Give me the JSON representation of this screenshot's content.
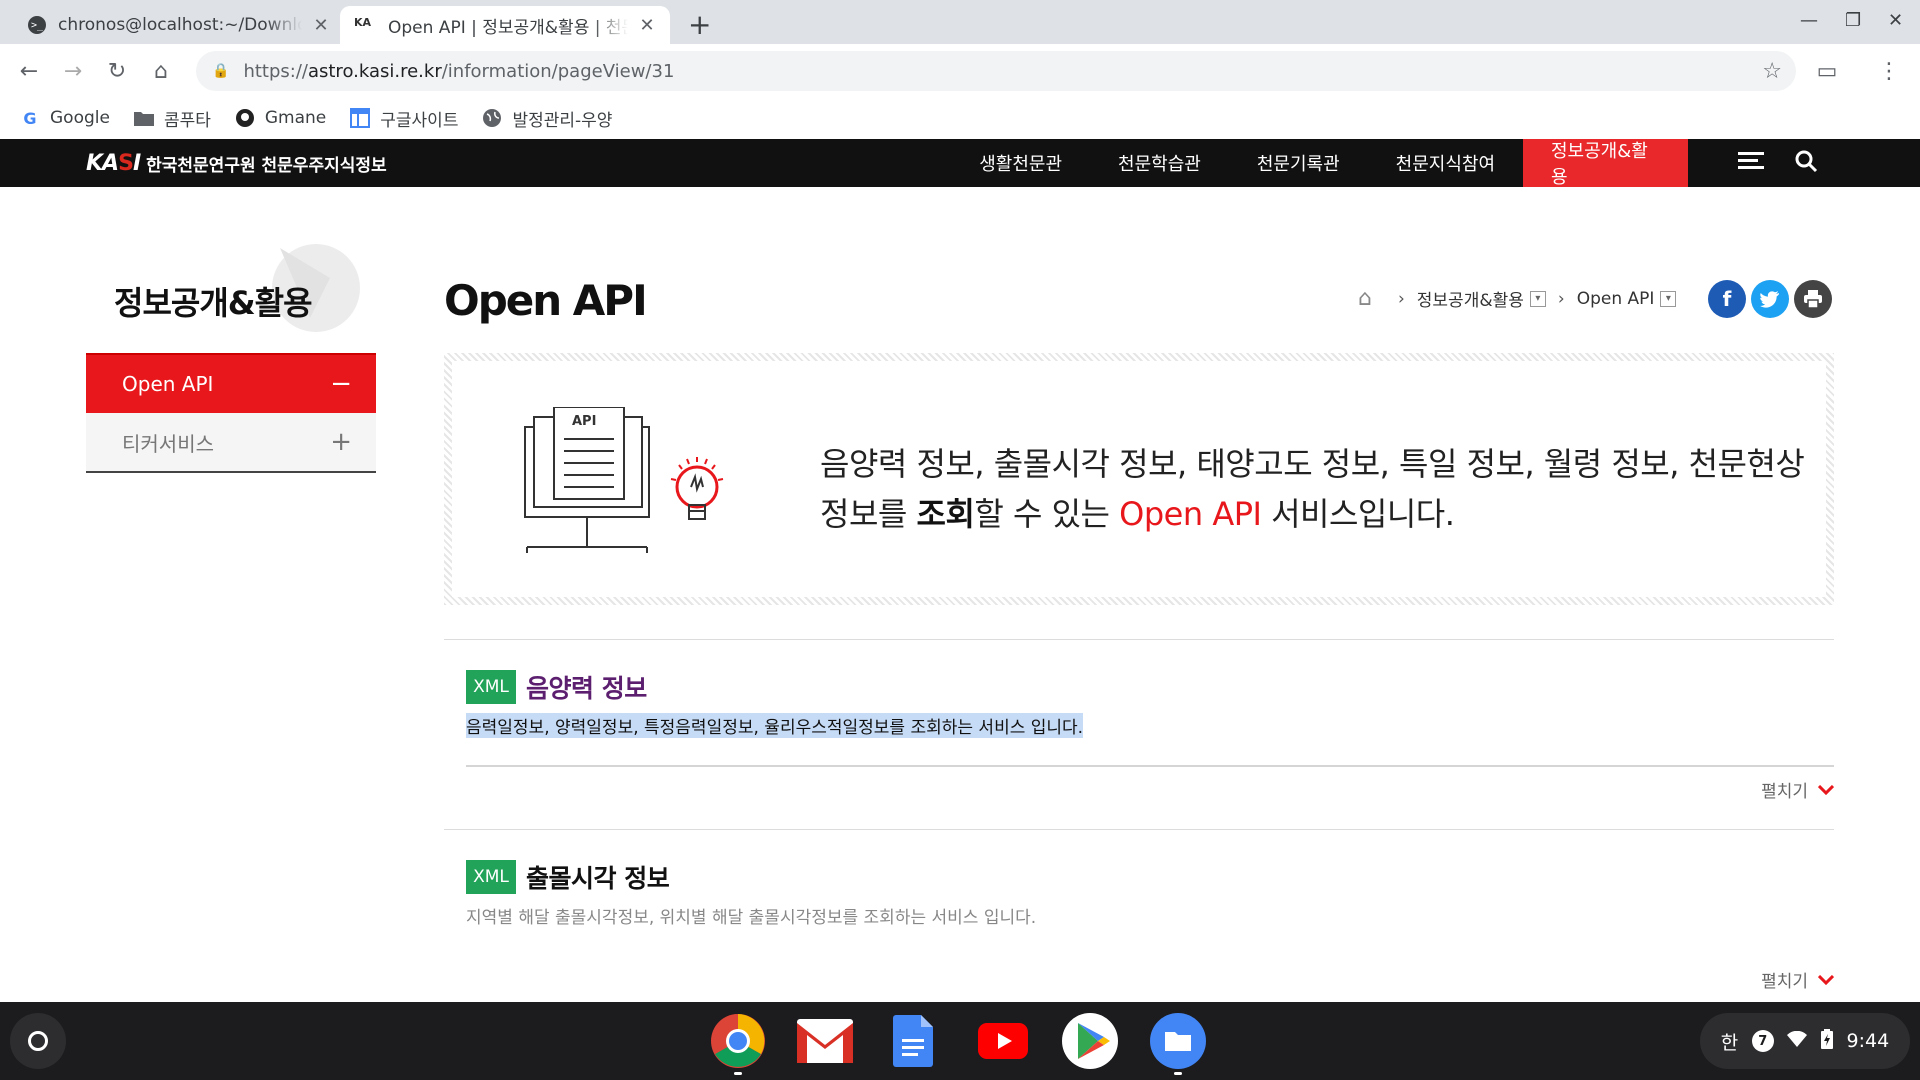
{
  "browser": {
    "tabs": [
      {
        "title": "chronos@localhost:~/Downloads",
        "active": false
      },
      {
        "title": "Open API | 정보공개&활용 | 천문우주지식정보",
        "active": true
      }
    ],
    "url_prefix": "https://",
    "url_host": "astro.kasi.re.kr",
    "url_path": "/information/pageView/31",
    "bookmarks": [
      {
        "label": "Google",
        "icon": "google-icon"
      },
      {
        "label": "콤푸타",
        "icon": "folder-icon"
      },
      {
        "label": "Gmane",
        "icon": "github-icon"
      },
      {
        "label": "구글사이트",
        "icon": "sites-icon"
      },
      {
        "label": "발정관리-우양",
        "icon": "globe-icon"
      }
    ]
  },
  "site": {
    "logo_mark": "KASI",
    "logo_text": "한국천문연구원 천문우주지식정보",
    "nav": [
      "생활천문관",
      "천문학습관",
      "천문기록관",
      "천문지식참여",
      "정보공개&활용"
    ],
    "nav_active_index": 4,
    "accent_color": "#e8171b"
  },
  "sidebar": {
    "title": "정보공개&활용",
    "items": [
      {
        "label": "Open API",
        "sign": "−",
        "active": true
      },
      {
        "label": "티커서비스",
        "sign": "+",
        "active": false
      }
    ]
  },
  "main": {
    "title": "Open API",
    "breadcrumb": [
      "정보공개&활용",
      "Open API"
    ],
    "intro": {
      "illus_label": "API",
      "line1": "음양력 정보, 출몰시각 정보, 태양고도 정보, 특일 정보, 월령 정보, 천문현상",
      "line2_a": "정보를 ",
      "line2_bold": "조회",
      "line2_b": "할 수 있는 ",
      "line2_red": "Open API",
      "line2_c": " 서비스입니다."
    },
    "apis": [
      {
        "badge": "XML",
        "title": "음양력 정보",
        "desc": "음력일정보, 양력일정보, 특정음력일정보, 율리우스적일정보를 조회하는 서비스 입니다.",
        "expand": "펼치기"
      },
      {
        "badge": "XML",
        "title": "출몰시각 정보",
        "desc": "지역별 해달 출몰시각정보, 위치별 해달 출몰시각정보를 조회하는 서비스 입니다.",
        "expand": "펼치기"
      }
    ]
  },
  "shelf": {
    "apps": [
      "chrome-icon",
      "gmail-icon",
      "docs-icon",
      "youtube-icon",
      "play-store-icon",
      "files-icon"
    ],
    "ime": "한",
    "notif_count": "7",
    "time": "9:44"
  }
}
